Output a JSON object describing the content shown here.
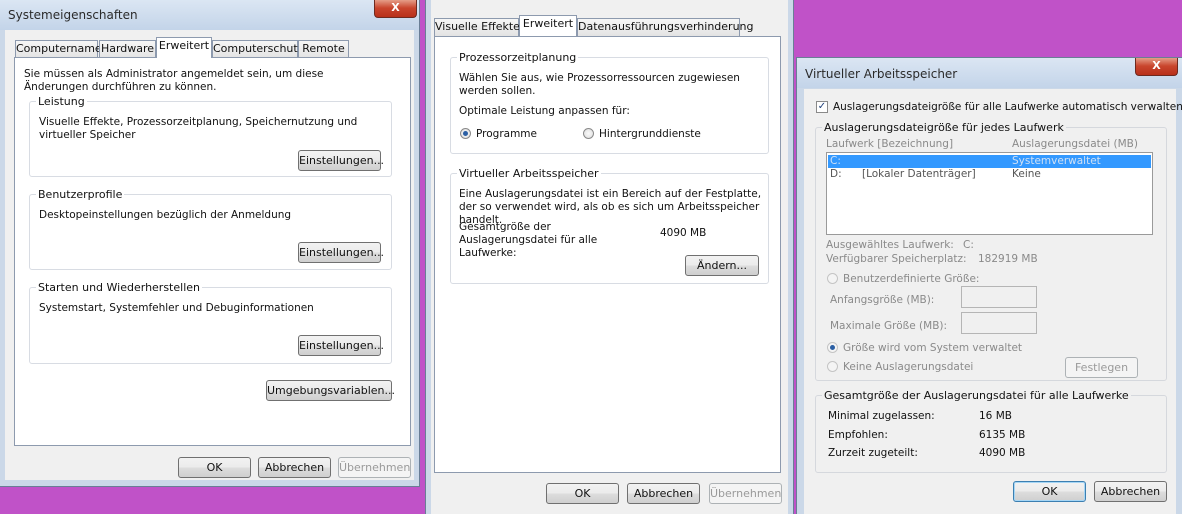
{
  "sysprops": {
    "title": "Systemeigenschaften",
    "close": "X",
    "tabs": [
      "Computername",
      "Hardware",
      "Erweitert",
      "Computerschutz",
      "Remote"
    ],
    "admin_note": "Sie müssen als Administrator angemeldet sein, um diese Änderungen durchführen zu können.",
    "groups": [
      {
        "title": "Leistung",
        "text": "Visuelle Effekte, Prozessorzeitplanung, Speichernutzung und virtueller Speicher",
        "button": "Einstellungen..."
      },
      {
        "title": "Benutzerprofile",
        "text": "Desktopeinstellungen bezüglich der Anmeldung",
        "button": "Einstellungen..."
      },
      {
        "title": "Starten und Wiederherstellen",
        "text": "Systemstart, Systemfehler und Debuginformationen",
        "button": "Einstellungen..."
      }
    ],
    "env_button": "Umgebungsvariablen...",
    "ok": "OK",
    "cancel": "Abbrechen",
    "apply": "Übernehmen"
  },
  "perf": {
    "tabs": [
      "Visuelle Effekte",
      "Erweitert",
      "Datenausführungsverhinderung"
    ],
    "sched_title": "Prozessorzeitplanung",
    "sched_text": "Wählen Sie aus, wie Prozessorressourcen zugewiesen werden sollen.",
    "optimize_label": "Optimale Leistung anpassen für:",
    "radio_programs": "Programme",
    "radio_background": "Hintergrunddienste",
    "vm_title": "Virtueller Arbeitsspeicher",
    "vm_text": "Eine Auslagerungsdatei ist ein Bereich auf der Festplatte, der so verwendet wird, als ob es sich um Arbeitsspeicher handelt.",
    "total_label": "Gesamtgröße der Auslagerungsdatei für alle Laufwerke:",
    "total_value": "4090 MB",
    "change_button": "Ändern...",
    "ok": "OK",
    "cancel": "Abbrechen",
    "apply": "Übernehmen"
  },
  "vm": {
    "title": "Virtueller Arbeitsspeicher",
    "close": "X",
    "auto_check": "Auslagerungsdateigröße für alle Laufwerke automatisch verwalten",
    "auto_checked": true,
    "per_drive_title": "Auslagerungsdateigröße für jedes Laufwerk",
    "col_drive": "Laufwerk [Bezeichnung]",
    "col_file": "Auslagerungsdatei (MB)",
    "drives": [
      {
        "letter": "C:",
        "label": "",
        "file": "Systemverwaltet"
      },
      {
        "letter": "D:",
        "label": "[Lokaler Datenträger]",
        "file": "Keine"
      }
    ],
    "selected_label": "Ausgewähltes Laufwerk:",
    "selected_value": "C:",
    "available_label": "Verfügbarer Speicherplatz:",
    "available_value": "182919 MB",
    "radio_custom": "Benutzerdefinierte Größe:",
    "initial_label": "Anfangsgröße (MB):",
    "max_label": "Maximale Größe (MB):",
    "radio_system": "Größe wird vom System verwaltet",
    "radio_none": "Keine Auslagerungsdatei",
    "set_button": "Festlegen",
    "total_title": "Gesamtgröße der Auslagerungsdatei für alle Laufwerke",
    "min_label": "Minimal zugelassen:",
    "min_value": "16 MB",
    "rec_label": "Empfohlen:",
    "rec_value": "6135 MB",
    "cur_label": "Zurzeit zugeteilt:",
    "cur_value": "4090 MB",
    "ok": "OK",
    "cancel": "Abbrechen"
  }
}
